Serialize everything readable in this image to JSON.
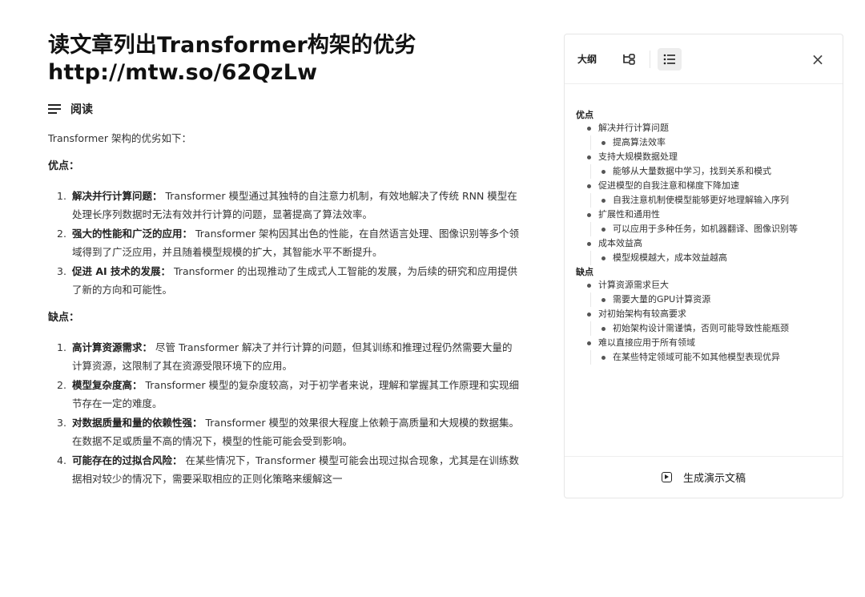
{
  "article": {
    "title_line1": "读文章列出Transformer构架的优劣",
    "title_line2": "http://mtw.so/62QzLw",
    "read_label": "阅读",
    "intro": "Transformer 架构的优劣如下：",
    "pros_heading": "优点：",
    "pros": [
      {
        "num": "1.",
        "lead": "解决并行计算问题：",
        "text": " Transformer 模型通过其独特的自注意力机制，有效地解决了传统 RNN 模型在处理长序列数据时无法有效并行计算的问题，显著提高了算法效率。"
      },
      {
        "num": "2.",
        "lead": "强大的性能和广泛的应用：",
        "text": " Transformer 架构因其出色的性能，在自然语言处理、图像识别等多个领域得到了广泛应用，并且随着模型规模的扩大，其智能水平不断提升。"
      },
      {
        "num": "3.",
        "lead": "促进 AI 技术的发展：",
        "text": " Transformer 的出现推动了生成式人工智能的发展，为后续的研究和应用提供了新的方向和可能性。"
      }
    ],
    "cons_heading": "缺点：",
    "cons": [
      {
        "num": "1.",
        "lead": "高计算资源需求：",
        "text": " 尽管 Transformer 解决了并行计算的问题，但其训练和推理过程仍然需要大量的计算资源，这限制了其在资源受限环境下的应用。"
      },
      {
        "num": "2.",
        "lead": "模型复杂度高：",
        "text": " Transformer 模型的复杂度较高，对于初学者来说，理解和掌握其工作原理和实现细节存在一定的难度。"
      },
      {
        "num": "3.",
        "lead": "对数据质量和量的依赖性强：",
        "text": " Transformer 模型的效果很大程度上依赖于高质量和大规模的数据集。在数据不足或质量不高的情况下，模型的性能可能会受到影响。"
      },
      {
        "num": "4.",
        "lead": "可能存在的过拟合风险：",
        "text": " 在某些情况下，Transformer 模型可能会出现过拟合现象，尤其是在训练数据相对较少的情况下，需要采取相应的正则化策略来缓解这一"
      }
    ]
  },
  "panel": {
    "header_label": "大纲",
    "close": "×",
    "outline_pros": "优点",
    "pros_items": [
      {
        "label": "解决并行计算问题",
        "sub": [
          "提高算法效率"
        ]
      },
      {
        "label": "支持大规模数据处理",
        "sub": [
          "能够从大量数据中学习，找到关系和模式"
        ]
      },
      {
        "label": "促进模型的自我注意和梯度下降加速",
        "sub": [
          "自我注意机制使模型能够更好地理解输入序列"
        ]
      },
      {
        "label": "扩展性和通用性",
        "sub": [
          "可以应用于多种任务，如机器翻译、图像识别等"
        ]
      },
      {
        "label": "成本效益高",
        "sub": [
          "模型规模越大，成本效益越高"
        ]
      }
    ],
    "outline_cons": "缺点",
    "cons_items": [
      {
        "label": "计算资源需求巨大",
        "sub": [
          "需要大量的GPU计算资源"
        ]
      },
      {
        "label": "对初始架构有较高要求",
        "sub": [
          "初始架构设计需谨慎，否则可能导致性能瓶颈"
        ]
      },
      {
        "label": "难以直接应用于所有领域",
        "sub": [
          "在某些特定领域可能不如其他模型表现优异"
        ]
      }
    ],
    "generate_label": "生成演示文稿"
  },
  "icons": {
    "read": "lines-icon",
    "mindmap": "mindmap-icon",
    "list": "list-icon",
    "close": "close-icon",
    "generate": "presentation-play-icon"
  }
}
